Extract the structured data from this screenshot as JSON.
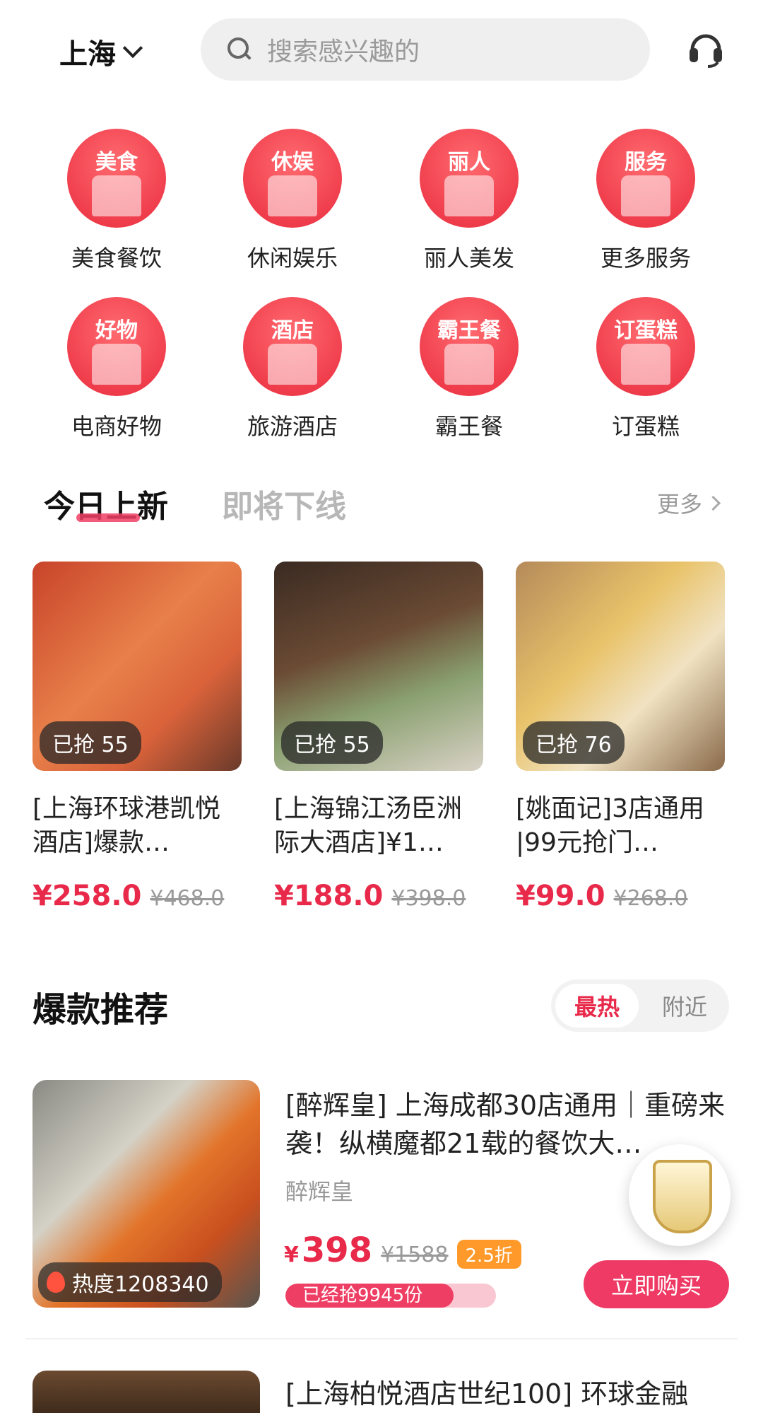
{
  "header": {
    "city": "上海",
    "search_placeholder": "搜索感兴趣的"
  },
  "categories": [
    {
      "tag": "美食",
      "label": "美食餐饮"
    },
    {
      "tag": "休娱",
      "label": "休闲娱乐"
    },
    {
      "tag": "丽人",
      "label": "丽人美发"
    },
    {
      "tag": "服务",
      "label": "更多服务"
    },
    {
      "tag": "好物",
      "label": "电商好物"
    },
    {
      "tag": "酒店",
      "label": "旅游酒店"
    },
    {
      "tag": "霸王餐",
      "label": "霸王餐"
    },
    {
      "tag": "订蛋糕",
      "label": "订蛋糕"
    }
  ],
  "tabs": {
    "active": "今日上新",
    "inactive": "即将下线",
    "more": "更多"
  },
  "new_products": [
    {
      "grabbed": "已抢 55",
      "title": "[上海环球港凯悦酒店]爆款…",
      "price": "¥258.0",
      "old_price": "¥468.0"
    },
    {
      "grabbed": "已抢 55",
      "title": "[上海锦江汤臣洲际大酒店]¥1…",
      "price": "¥188.0",
      "old_price": "¥398.0"
    },
    {
      "grabbed": "已抢 76",
      "title": "[姚面记]3店通用 |99元抢门…",
      "price": "¥99.0",
      "old_price": "¥268.0"
    }
  ],
  "hot": {
    "title": "爆款推荐",
    "toggle_on": "最热",
    "toggle_off": "附近",
    "item": {
      "heat": "热度1208340",
      "title": "[醉辉皇] 上海成都30店通用｜重磅来袭！纵横魔都21载的餐饮大…",
      "shop": "醉辉皇",
      "currency": "¥",
      "price": "398",
      "old_price": "¥1588",
      "discount": "2.5折",
      "sold": "已经抢9945份",
      "sold_progress_percent": 80,
      "buy_label": "立即购买"
    },
    "next_title": "[上海柏悦酒店世纪100] 环球金融"
  },
  "colors": {
    "accent": "#e8294a",
    "button": "#ee3a64",
    "category_red": "#f03e4d"
  }
}
